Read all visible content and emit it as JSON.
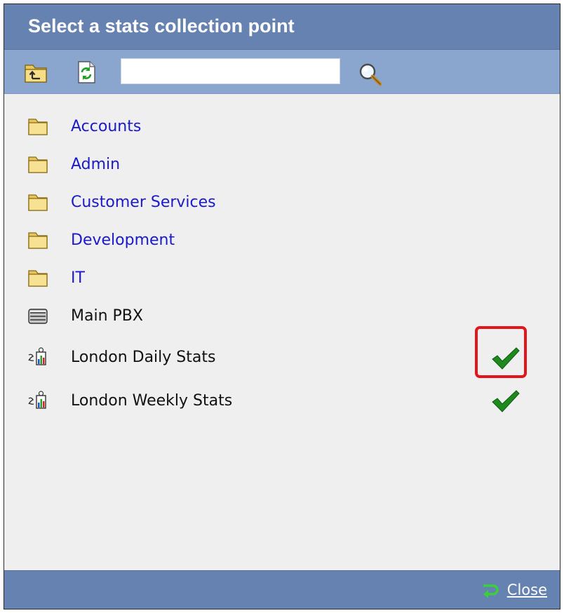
{
  "dialog": {
    "title": "Select a stats collection point"
  },
  "toolbar": {
    "up_icon": "folder-up-icon",
    "refresh_icon": "refresh-icon",
    "search": {
      "value": "",
      "placeholder": ""
    },
    "search_icon": "magnifier-icon"
  },
  "list": {
    "items": [
      {
        "label": "Accounts",
        "icon": "folder-icon",
        "link": true,
        "selected": false
      },
      {
        "label": "Admin",
        "icon": "folder-icon",
        "link": true,
        "selected": false
      },
      {
        "label": "Customer Services",
        "icon": "folder-icon",
        "link": true,
        "selected": false
      },
      {
        "label": "Development",
        "icon": "folder-icon",
        "link": true,
        "selected": false
      },
      {
        "label": "IT",
        "icon": "folder-icon",
        "link": true,
        "selected": false
      },
      {
        "label": "Main PBX",
        "icon": "pbx-server-icon",
        "link": false,
        "selected": false
      },
      {
        "label": "London Daily Stats",
        "icon": "stats-chart-icon",
        "link": false,
        "selected": true
      },
      {
        "label": "London Weekly Stats",
        "icon": "stats-chart-icon",
        "link": false,
        "selected": true
      }
    ]
  },
  "footer": {
    "close_label": "Close",
    "close_icon": "return-arrow-icon"
  },
  "colors": {
    "title_bar": "#6582b0",
    "toolbar": "#8aa6cf",
    "content_bg": "#efefef",
    "link": "#1a1acc",
    "check": "#1e8a1e",
    "highlight": "#e3141b"
  }
}
